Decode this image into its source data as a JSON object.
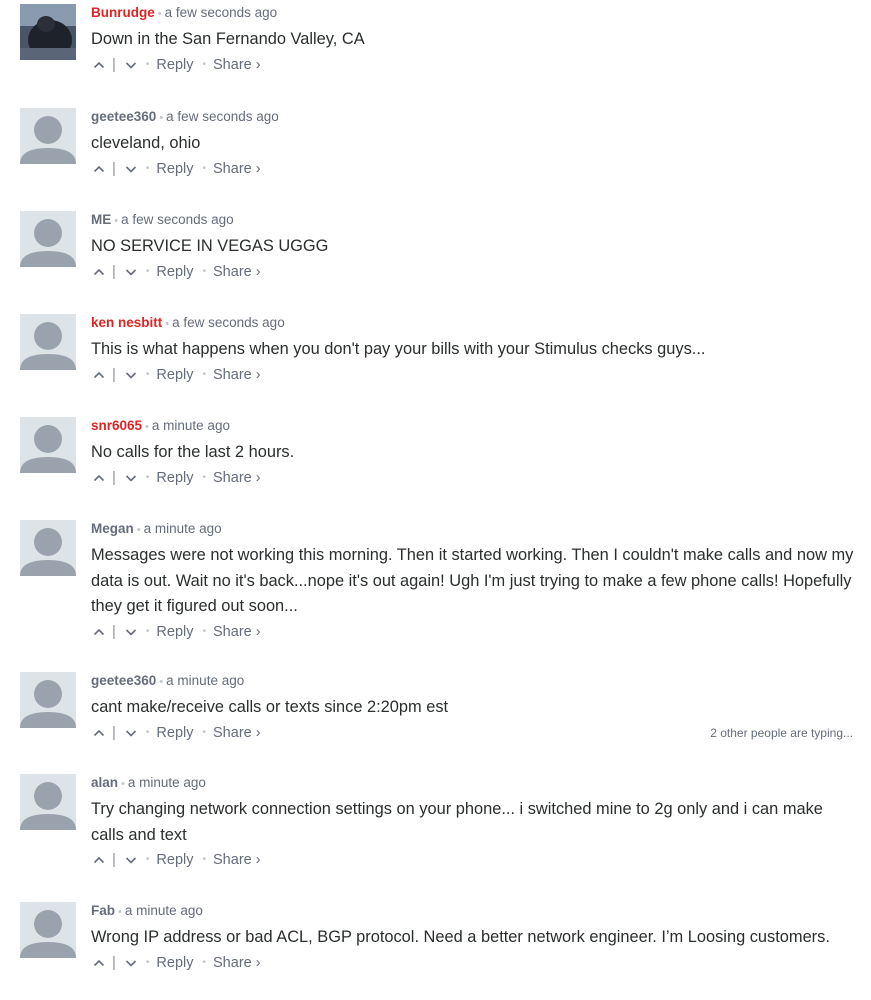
{
  "actions": {
    "reply": "Reply",
    "share": "Share ›"
  },
  "comments": [
    {
      "author": "Bunrudge",
      "time": "a few seconds ago",
      "text": "Down in the San Fernando Valley, CA"
    },
    {
      "author": "geetee360",
      "time": "a few seconds ago",
      "text": "cleveland, ohio"
    },
    {
      "author": "ME",
      "time": "a few seconds ago",
      "text": "NO SERVICE IN VEGAS UGGG"
    },
    {
      "author": "ken nesbitt",
      "time": "a few seconds ago",
      "text": "This is what happens when you don't pay your bills with your Stimulus checks guys..."
    },
    {
      "author": "snr6065",
      "time": "a minute ago",
      "text": "No calls for the last 2 hours."
    },
    {
      "author": "Megan",
      "time": "a minute ago",
      "text": "Messages were not working this morning. Then it started working. Then I couldn't make calls and now my data is out. Wait no it's back...nope it's out again! Ugh I'm just trying to make a few phone calls! Hopefully they get it figured out soon..."
    },
    {
      "author": "geetee360",
      "time": "a minute ago",
      "text": "cant make/receive calls or texts since 2:20pm est",
      "typing": "2 other people are typing..."
    },
    {
      "author": "alan",
      "time": "a minute ago",
      "text": "Try changing network connection settings on your phone... i switched mine to 2g only and i can make calls and text"
    },
    {
      "author": "Fab",
      "time": "a minute ago",
      "text": "Wrong IP address or bad ACL, BGP protocol. Need a better network engineer. I’m Loosing customers."
    }
  ],
  "colors": {
    "author_highlight": "#e02424",
    "author_default": "#656c7a",
    "text": "#2a2e2e",
    "avatar_placeholder": "#dee3e7",
    "avatar_silhouette": "#9aa3ad"
  },
  "icons": {
    "upvote": "chevron-up-icon",
    "downvote": "chevron-down-icon",
    "avatar": "default-user-avatar-icon"
  }
}
